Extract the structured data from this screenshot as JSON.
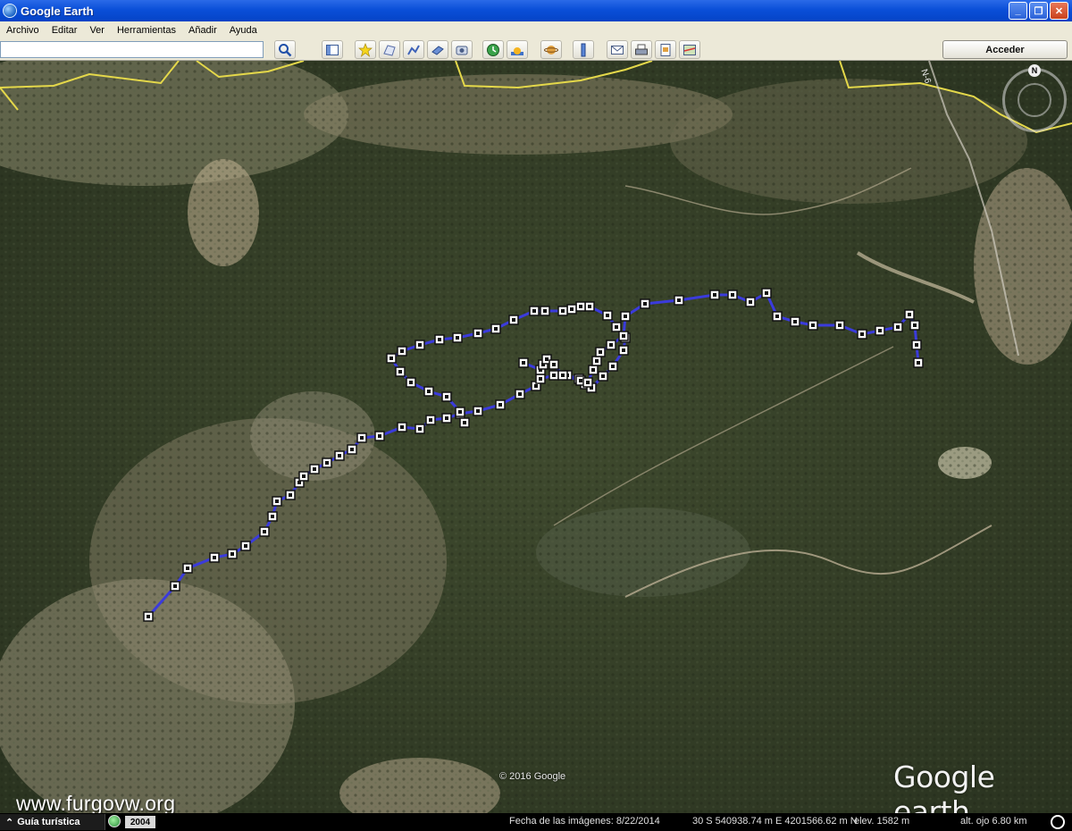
{
  "window": {
    "title": "Google Earth",
    "minimize_label": "_",
    "maximize_label": "❐",
    "close_label": "✕"
  },
  "menu": {
    "items": [
      "Archivo",
      "Editar",
      "Ver",
      "Herramientas",
      "Añadir",
      "Ayuda"
    ]
  },
  "toolbar": {
    "search_value": "",
    "signin_label": "Acceder",
    "icons": [
      "search-icon",
      "sidebar-icon",
      "placemark-icon",
      "polygon-icon",
      "path-icon",
      "overlay-icon",
      "record-tour-icon",
      "historical-imagery-icon",
      "sunlight-icon",
      "planets-icon",
      "ruler-icon",
      "email-icon",
      "print-icon",
      "save-image-icon",
      "view-in-maps-icon"
    ]
  },
  "map": {
    "copyright": "© 2016 Google",
    "logo_google": "Google",
    "logo_earth": " earth",
    "watermark": "www.furgovw.org",
    "compass_north": "N",
    "road_label": "N-6",
    "track_color": "#3b3bdc",
    "border_color": "#e4d84a"
  },
  "status": {
    "tour_label": "Guía turística",
    "year": "2004",
    "imagery_date": "Fecha de las imágenes: 8/22/2014",
    "coordinates": "30 S 540938.74 m E 4201566.62 m N",
    "elevation": "elev.  1582 m",
    "eye_altitude": "alt. ojo   6.80 km"
  }
}
